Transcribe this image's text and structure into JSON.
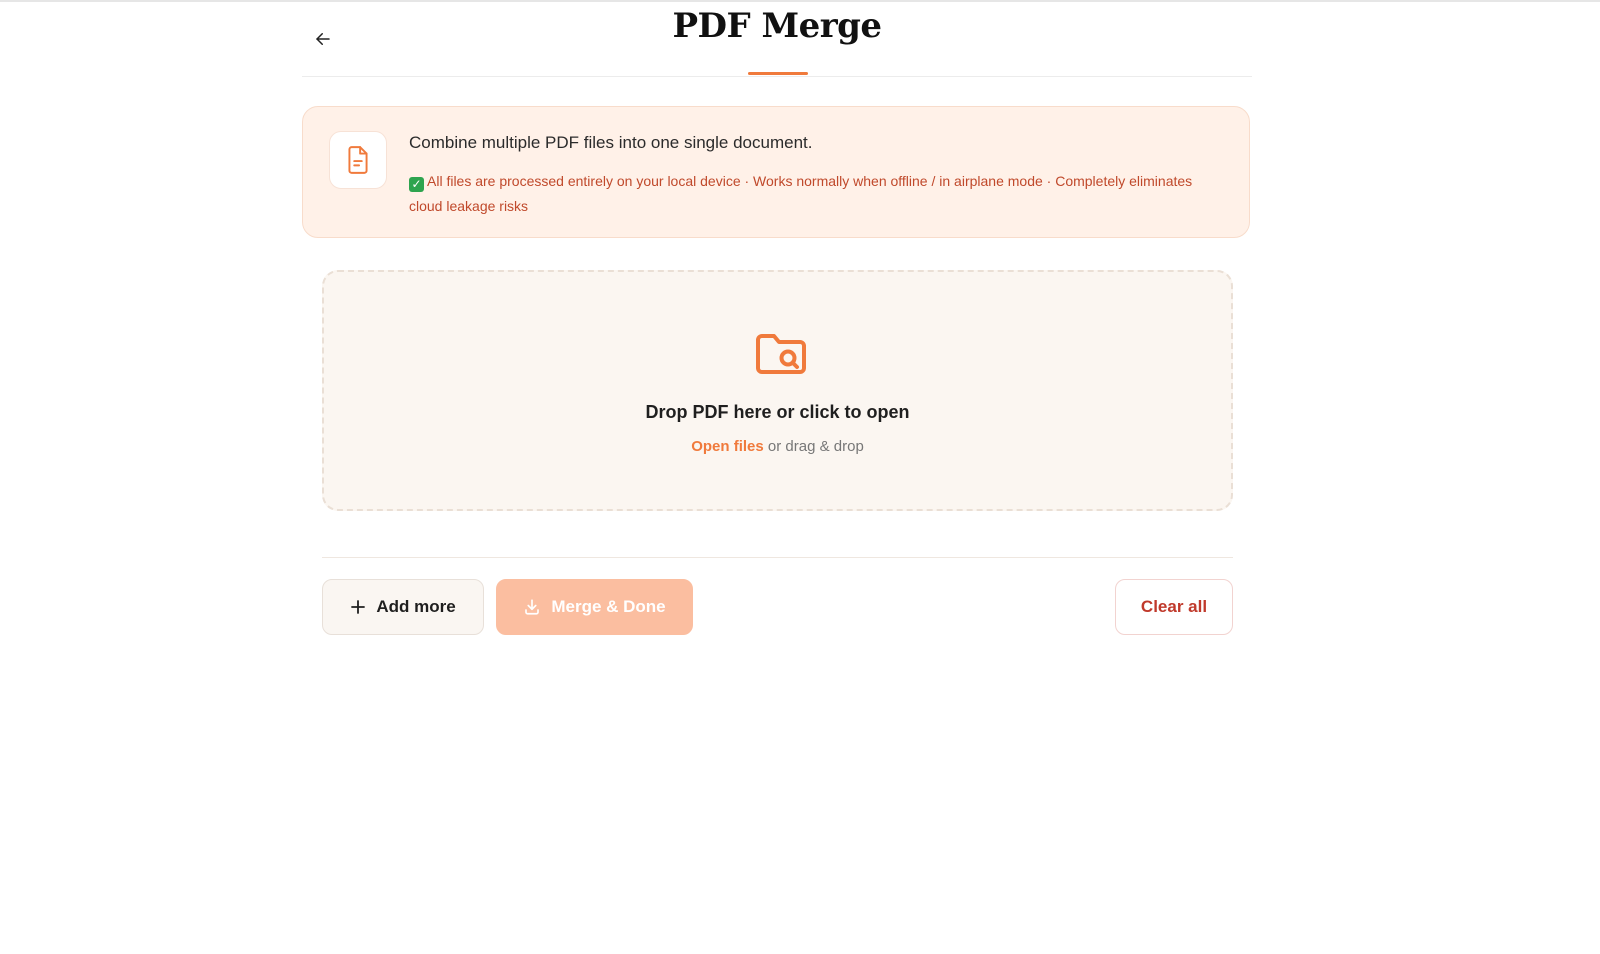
{
  "header": {
    "title": "PDF Merge"
  },
  "banner": {
    "icon": "file-text-icon",
    "title": "Combine multiple PDF files into one single document.",
    "note": "All files are processed entirely on your local device · Works normally when offline / in airplane mode · Completely eliminates cloud leakage risks"
  },
  "dropzone": {
    "icon": "folder-search-icon",
    "title": "Drop PDF here or click to open",
    "link": "Open files",
    "sub_suffix": "or drag & drop"
  },
  "actions": {
    "add_more": "Add more",
    "merge_done": "Merge & Done",
    "clear_all": "Clear all"
  },
  "colors": {
    "accent": "#f07a3c",
    "banner_bg": "#fff1e8",
    "note_text": "#c0492b",
    "merge_disabled": "#fbbea0",
    "danger": "#c0392b"
  }
}
